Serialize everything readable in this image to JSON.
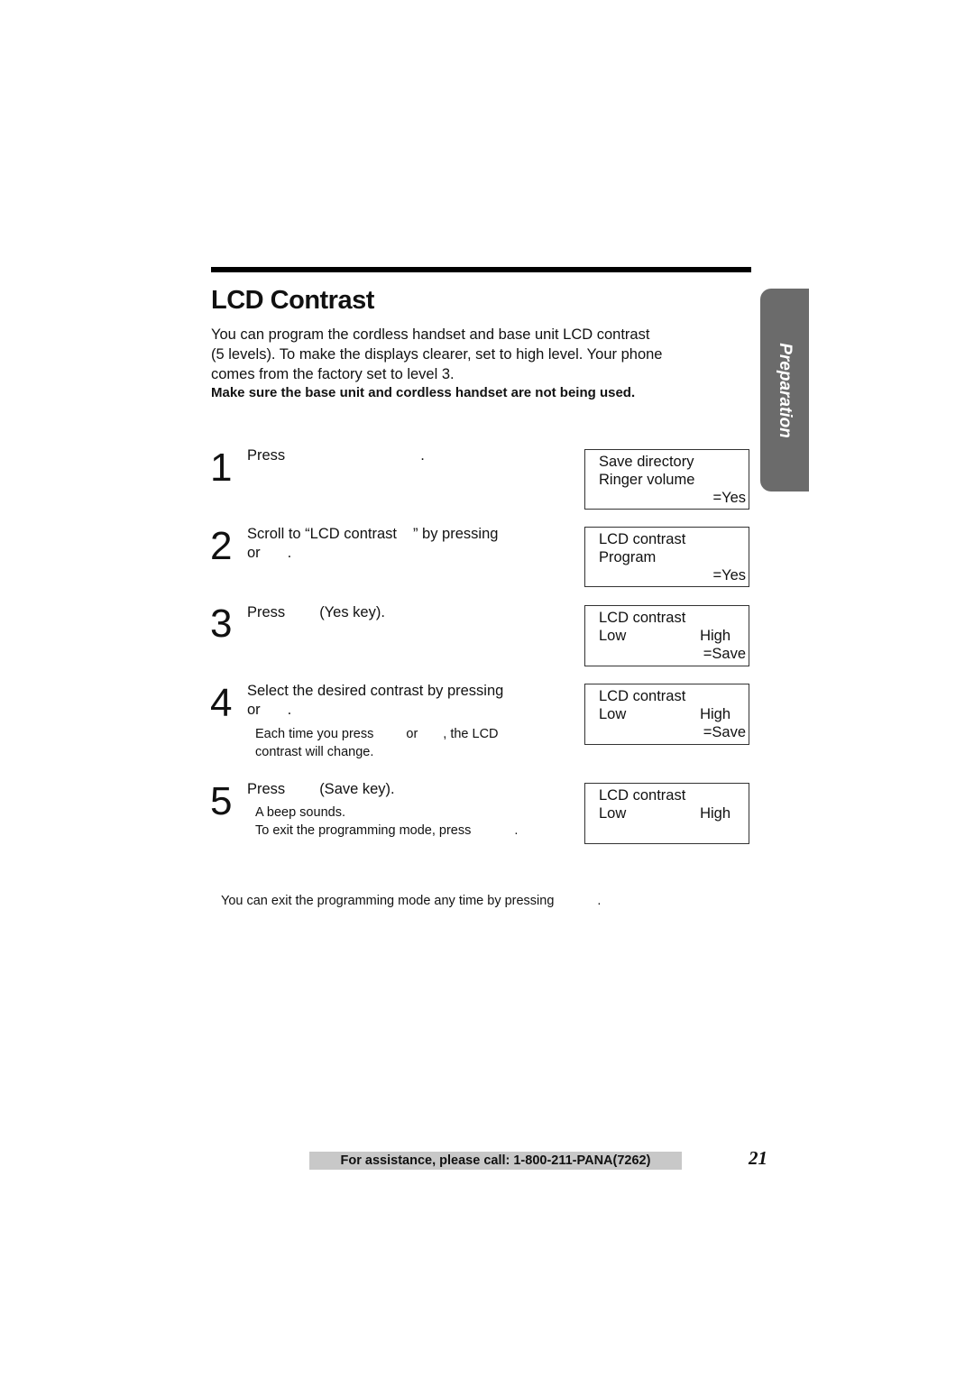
{
  "section": {
    "title": "LCD Contrast",
    "intro_lines": [
      "You can program the cordless handset and base unit LCD contrast",
      "(5 levels). To make the displays clearer, set to high level. Your phone",
      "comes from the factory set to level 3."
    ],
    "warning": "Make sure the base unit and cordless handset are not being used."
  },
  "side_tab": {
    "label": "Preparation"
  },
  "steps": [
    {
      "number": "1",
      "line1_a": "Press",
      "line1_b": "."
    },
    {
      "number": "2",
      "line1_a": "Scroll to “LCD contrast",
      "line1_b": "” by pressing",
      "line2_a": "or",
      "line2_b": "."
    },
    {
      "number": "3",
      "line1_a": "Press",
      "line1_b": "(Yes key)."
    },
    {
      "number": "4",
      "line1": "Select the desired contrast by pressing",
      "line2_a": "or",
      "line2_b": ".",
      "sub1_a": "Each time you press",
      "sub1_b": "or",
      "sub1_c": ", the LCD",
      "sub2": "contrast will change."
    },
    {
      "number": "5",
      "line1_a": "Press",
      "line1_b": "(Save key).",
      "sub1": "A beep sounds.",
      "sub2_a": "To exit the programming mode, press",
      "sub2_b": "."
    }
  ],
  "displays": [
    {
      "line1": "Save directory",
      "line2": "Ringer volume",
      "line2_right": "",
      "line3": "=Yes"
    },
    {
      "line1": "LCD contrast",
      "line2": "Program",
      "line2_right": "",
      "line3": "=Yes"
    },
    {
      "line1": "LCD contrast",
      "line2": "Low",
      "line2_right": "High",
      "line3": "=Save"
    },
    {
      "line1": "LCD contrast",
      "line2": "Low",
      "line2_right": "High",
      "line3": "=Save"
    },
    {
      "line1": "LCD contrast",
      "line2": "Low",
      "line2_right": "High",
      "line3": ""
    }
  ],
  "note": {
    "text_a": "You can exit the programming mode any time by pressing",
    "text_b": "."
  },
  "footer": {
    "assistance": "For assistance, please call: 1-800-211-PANA(7262)",
    "page_number": "21"
  }
}
